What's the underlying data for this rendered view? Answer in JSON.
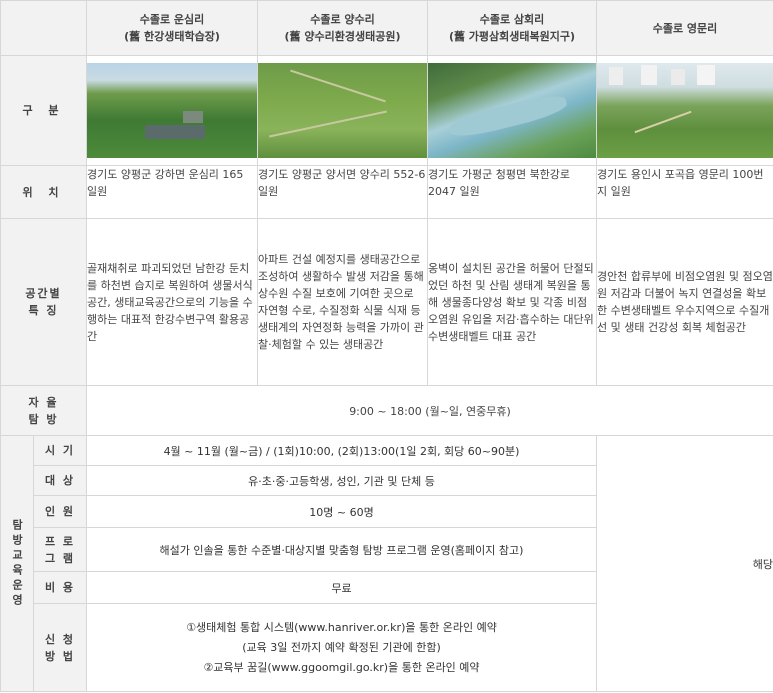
{
  "columns": [
    {
      "name": "수졸로 운심리",
      "sub": "(舊 한강생태학습장)"
    },
    {
      "name": "수졸로 양수리",
      "sub": "(舊 양수리환경생태공원)"
    },
    {
      "name": "수졸로 삼회리",
      "sub": "(舊 가평삼회생태복원지구)"
    },
    {
      "name": "수졸로 영문리",
      "sub": ""
    }
  ],
  "rows": {
    "category_label": "구  분",
    "location_label": "위  치",
    "features_label": "공간별\n특  징",
    "free_visit_label": "자  율\n탐  방",
    "program_group_label": "탐방교육운영",
    "locations": [
      "경기도 양평군 강하면 운심리 165 일원",
      "경기도 양평군 양서면 양수리 552-6 일원",
      "경기도 가평군 청평면 북한강로2047 일원",
      "경기도 용인시 포곡읍 영문리 100번지 일원"
    ],
    "features": [
      "골재채취로 파괴되었던 남한강 둔치를 하천변 습지로 복원하여 생물서식공간, 생태교육공간으로의 기능을 수행하는 대표적 한강수변구역 활용공간",
      "아파트 건설 예정지를 생태공간으로 조성하여 생활하수 발생 저감을 통해 상수원 수질 보호에 기여한 곳으로 자연형 수로, 수질정화 식물 식재 등 생태계의 자연정화 능력을 가까이 관찰·체험할 수 있는 생태공간",
      "옹벽이 설치된 공간을 허물어 단절되었던 하천 및 산림 생태계 복원을 통해 생물종다양성 확보 및 각종 비점오염원 유입을 저감·흡수하는 대단위 수변생태벨트 대표 공간",
      "경안천 합류부에 비점오염원 및 점오염원 저감과 더불어 녹지 연결성을 확보한 수변생태벨트 우수지역으로 수질개선 및 생태 건강성 회복 체험공간"
    ],
    "free_visit_value": "9:00 ~ 18:00 (월~일, 연중무휴)",
    "program": [
      {
        "label": "시  기",
        "value": "4월 ~ 11월 (월~금) / (1회)10:00, (2회)13:00(1일 2회, 회당 60~90분)"
      },
      {
        "label": "대  상",
        "value": "유·초·중·고등학생, 성인, 기관 및 단체 등"
      },
      {
        "label": "인  원",
        "value": "10명 ~ 60명"
      },
      {
        "label": "프  로\n그  램",
        "value": "해설가 인솔을 통한 수준별·대상지별 맞춤형 탐방 프로그램 운영(홈페이지 참고)"
      },
      {
        "label": "비  용",
        "value": "무료"
      },
      {
        "label": "신  청\n방  법",
        "value": "①생태체험 통합 시스템(www.hanriver.or.kr)을 통한 온라인 예약\n(교육 3일 전까지 예약 확정된 기관에 한함)\n②교육부 꿈길(www.ggoomgil.go.kr)을 통한 온라인 예약"
      }
    ],
    "last_col_note": "해당"
  },
  "photos": [
    "운심리 aerial photo",
    "양수리 aerial photo",
    "삼회리 aerial photo",
    "영문리 aerial photo"
  ]
}
